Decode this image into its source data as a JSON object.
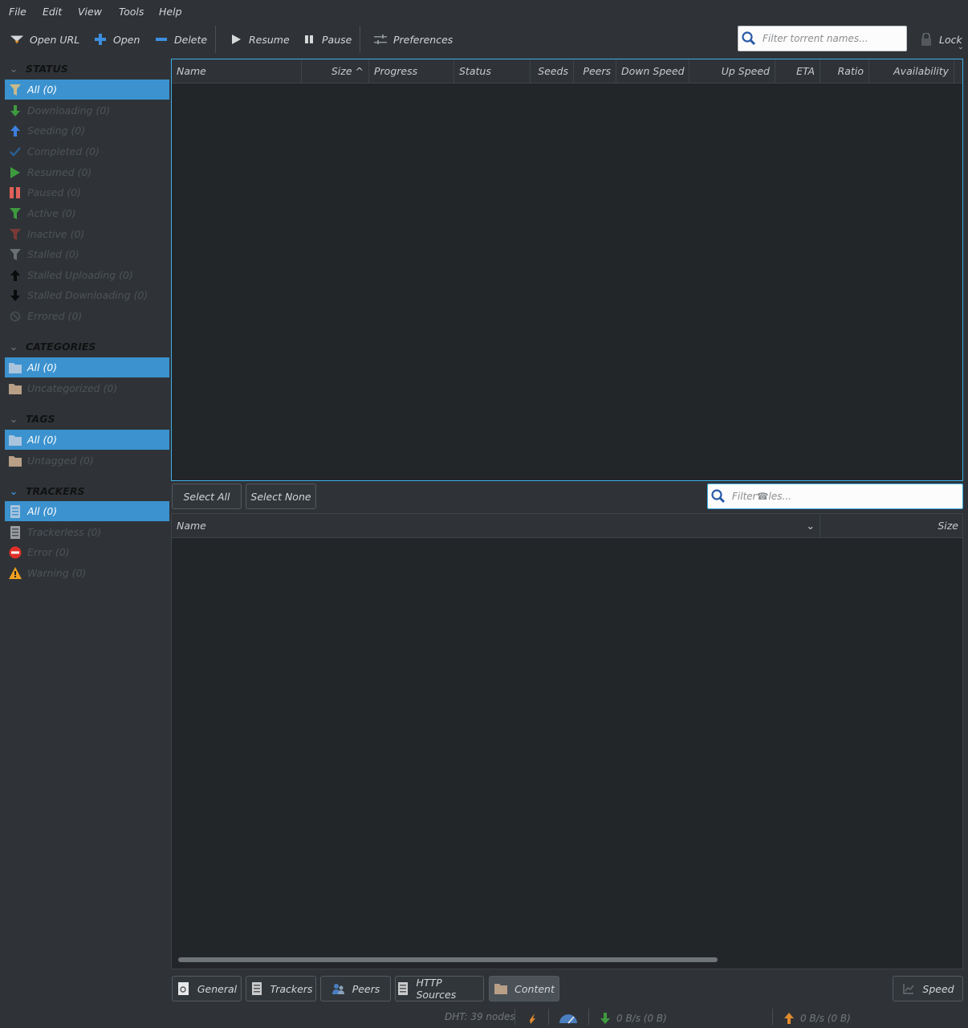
{
  "menu": [
    "File",
    "Edit",
    "View",
    "Tools",
    "Help"
  ],
  "toolbar": {
    "open_url": "Open URL",
    "open": "Open",
    "delete": "Delete",
    "resume": "Resume",
    "pause": "Pause",
    "preferences": "Preferences",
    "lock": "Lock",
    "filter_placeholder": "Filter torrent names..."
  },
  "sidebar": {
    "status_title": "STATUS",
    "status_items": [
      "All (0)",
      "Downloading (0)",
      "Seeding (0)",
      "Completed (0)",
      "Resumed (0)",
      "Paused (0)",
      "Active (0)",
      "Inactive (0)",
      "Stalled (0)",
      "Stalled Uploading (0)",
      "Stalled Downloading (0)",
      "Errored (0)"
    ],
    "categories_title": "CATEGORIES",
    "category_items": [
      "All (0)",
      "Uncategorized (0)"
    ],
    "tags_title": "TAGS",
    "tag_items": [
      "All (0)",
      "Untagged (0)"
    ],
    "trackers_title": "TRACKERS",
    "tracker_items": [
      "All (0)",
      "Trackerless (0)",
      "Error (0)",
      "Warning (0)"
    ]
  },
  "torrent_columns": [
    "Name",
    "Size",
    "Progress",
    "Status",
    "Seeds",
    "Peers",
    "Down Speed",
    "Up Speed",
    "ETA",
    "Ratio",
    "Availability"
  ],
  "files": {
    "select_all": "Select All",
    "select_none": "Select None",
    "filter_placeholder": "Filter☎les...",
    "columns": [
      "Name",
      "Size"
    ]
  },
  "tabs": [
    "General",
    "Trackers",
    "Peers",
    "HTTP Sources",
    "Content"
  ],
  "speed_button": "Speed",
  "status_bar": {
    "dht": "DHT: 39 nodes",
    "down": "0 B/s (0 B)",
    "up": "0 B/s (0 B)"
  },
  "colors": {
    "selection": "#3b92cf",
    "focus_border": "#3daee9",
    "background": "#2f3337",
    "table_background": "#232629"
  }
}
